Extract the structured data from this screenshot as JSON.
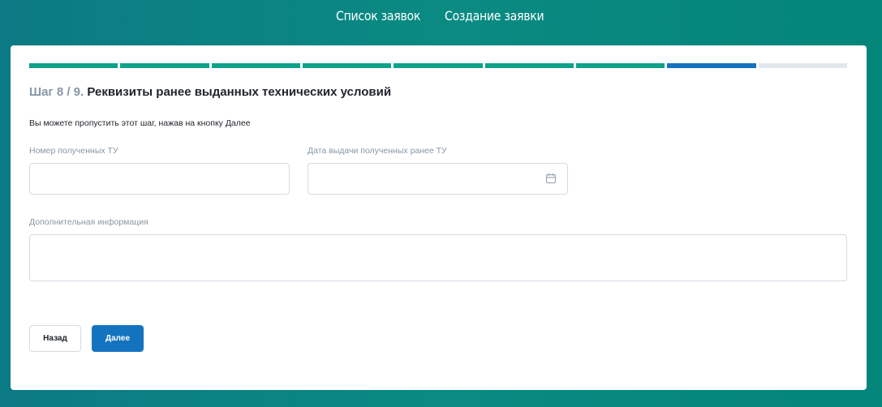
{
  "nav": {
    "items": [
      {
        "label": "Список заявок"
      },
      {
        "label": "Создание заявки"
      }
    ]
  },
  "progress": {
    "current_step": 8,
    "total_steps": 9,
    "colors": {
      "done": "#11a08a",
      "current": "#1473bf",
      "todo": "#e3e8ee"
    }
  },
  "step": {
    "prefix": "Шаг 8 / 9.",
    "title": "Реквизиты ранее выданных технических условий"
  },
  "hint": "Вы можете пропустить этот шаг, нажав на кнопку Далее",
  "form": {
    "number_label": "Номер полученных ТУ",
    "number_value": "",
    "date_label": "Дата выдачи полученных ранее ТУ",
    "date_value": "",
    "date_icon": "calendar-icon",
    "extra_label": "Дополнительная информация",
    "extra_value": ""
  },
  "buttons": {
    "back": "Назад",
    "next": "Далее"
  }
}
